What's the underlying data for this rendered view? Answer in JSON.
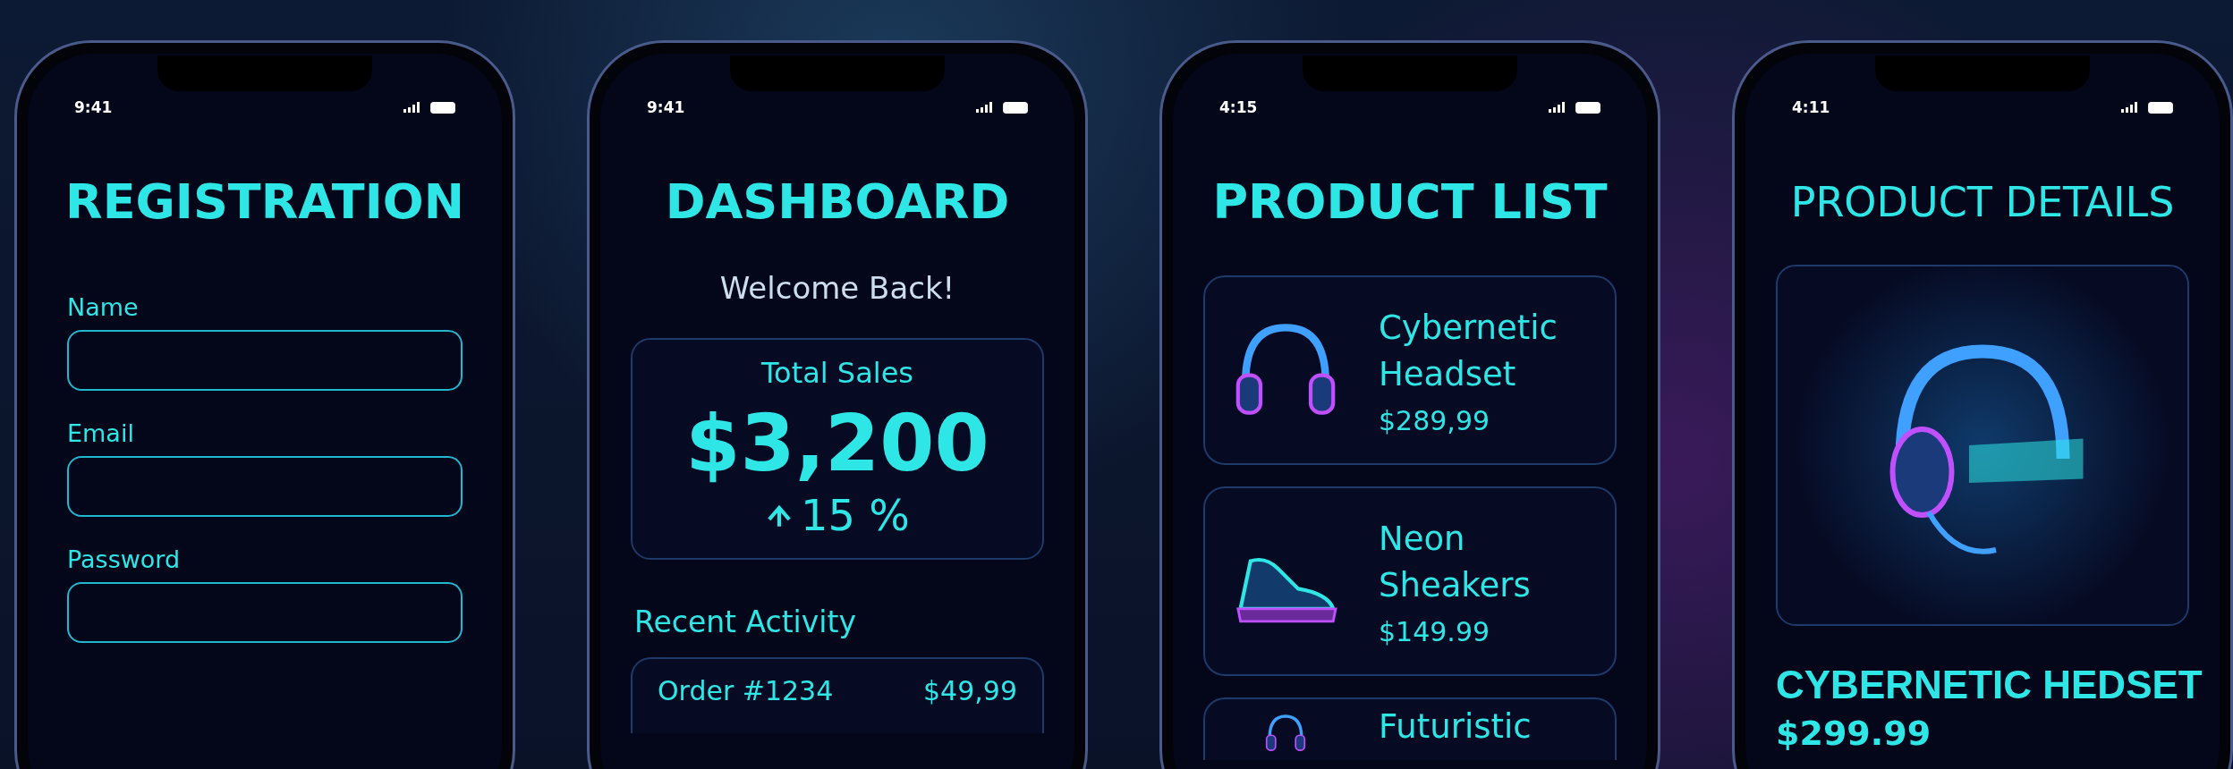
{
  "phones": [
    {
      "kind": "registration",
      "time": "9:41",
      "title": "REGISTRATION",
      "fields": [
        {
          "label": "Name"
        },
        {
          "label": "Email"
        },
        {
          "label": "Password"
        }
      ]
    },
    {
      "kind": "dashboard",
      "time": "9:41",
      "title": "DASHBOARD",
      "greeting": "Welcome Back!",
      "stat": {
        "label": "Total Sales",
        "value": "$3,200",
        "change": "15 %"
      },
      "section": "Recent Activity",
      "activity": [
        {
          "label": "Order #1234",
          "amount": "$49,99"
        }
      ]
    },
    {
      "kind": "product_list",
      "time": "4:15",
      "title": "PRODUCT LIST",
      "products": [
        {
          "kind": "headset",
          "name": "Cybernetic Headset",
          "price": "$289,99"
        },
        {
          "kind": "sneaker",
          "name": "Neon Sheakers",
          "price": "$149.99"
        },
        {
          "kind": "headset",
          "name": "Futuristic"
        }
      ]
    },
    {
      "kind": "product_details",
      "time": "4:11",
      "title": "PRODUCT DETAILS",
      "name": "CYBERNETIC HEDSET",
      "price": "$299.99"
    }
  ]
}
